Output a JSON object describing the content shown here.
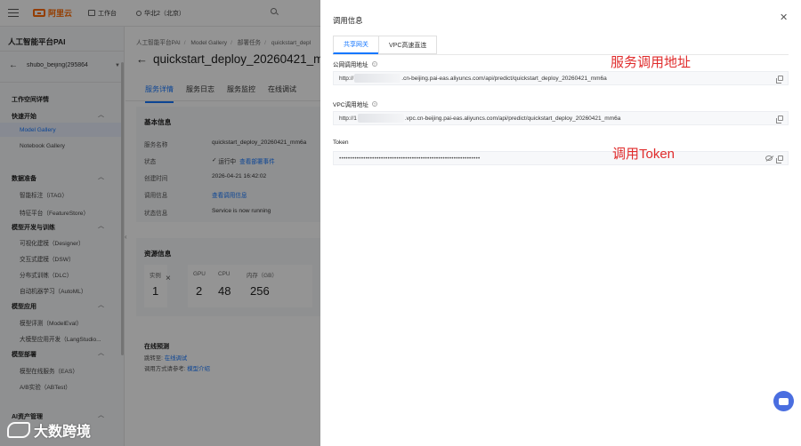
{
  "topbar": {
    "logo_text": "阿里云",
    "workbench": "工作台",
    "region": "华北2（北京）",
    "search": ""
  },
  "sidebar": {
    "title": "人工智能平台PAI",
    "workspace": "shubo_beijing(295864",
    "sections": [
      {
        "label": "工作空间详情",
        "items": []
      },
      {
        "label": "快速开始",
        "items": [
          "Model Gallery",
          "Notebook Gallery"
        ]
      },
      {
        "label": "数据准备",
        "items": [
          "智能标注（iTAG）",
          "特征平台（FeatureStore）"
        ]
      },
      {
        "label": "模型开发与训练",
        "items": [
          "可视化建模（Designer）",
          "交互式建模（DSW）",
          "分布式训练（DLC）",
          "自动机器学习（AutoML）"
        ]
      },
      {
        "label": "模型应用",
        "items": [
          "模型评测（ModelEval）",
          "大模型应用开发（LangStudio..."
        ]
      },
      {
        "label": "模型部署",
        "items": [
          "模型在线服务（EAS）",
          "A/B实验（ABTest）"
        ]
      },
      {
        "label": "AI资产管理",
        "items": []
      }
    ]
  },
  "main": {
    "breadcrumbs": [
      "人工智能平台PAI",
      "Model Gallery",
      "部署任务",
      "quickstart_depl"
    ],
    "title": "quickstart_deploy_20260421_mm6a",
    "tabs": [
      "服务详情",
      "服务日志",
      "服务监控",
      "在线调试"
    ],
    "basic": {
      "heading": "基本信息",
      "rows": [
        {
          "k": "服务名称",
          "v": "quickstart_deploy_20260421_mm6a"
        },
        {
          "k": "状态",
          "v": "运行中",
          "extra": "查看部署事件"
        },
        {
          "k": "创建时间",
          "v": "2026-04-21 16:42:02"
        },
        {
          "k": "调用信息",
          "v": "查看调用信息"
        },
        {
          "k": "状态信息",
          "v": "Service is now running"
        }
      ]
    },
    "resource": {
      "heading": "资源信息",
      "instances_label": "实例",
      "instances": "1",
      "gpu_label": "GPU",
      "gpu": "2",
      "cpu_label": "CPU",
      "cpu": "48",
      "mem_label": "内存（GB）",
      "mem": "256"
    },
    "online": {
      "heading": "在线预测",
      "jump_label": "跳转至:",
      "jump_link": "在线调试",
      "ref_label": "调用方式请参考:",
      "ref_link": "模型介绍"
    }
  },
  "drawer": {
    "title": "调用信息",
    "tabs": [
      "共享网关",
      "VPC高速直连"
    ],
    "public_label": "公网调用地址",
    "public_prefix": "http://",
    "public_suffix": ".cn-beijing.pai-eas.aliyuncs.com/api/predict/quickstart_deploy_20260421_mm6a",
    "vpc_label": "VPC调用地址",
    "vpc_prefix": "http://1",
    "vpc_suffix": ".vpc.cn-beijing.pai-eas.aliyuncs.com/api/predict/quickstart_deploy_20260421_mm6a",
    "token_label": "Token",
    "token_value": "••••••••••••••••••••••••••••••••••••••••••••••••••••••••••••••••"
  },
  "annotations": {
    "address": "服务调用地址",
    "token": "调用Token"
  },
  "watermark": "大数跨境"
}
